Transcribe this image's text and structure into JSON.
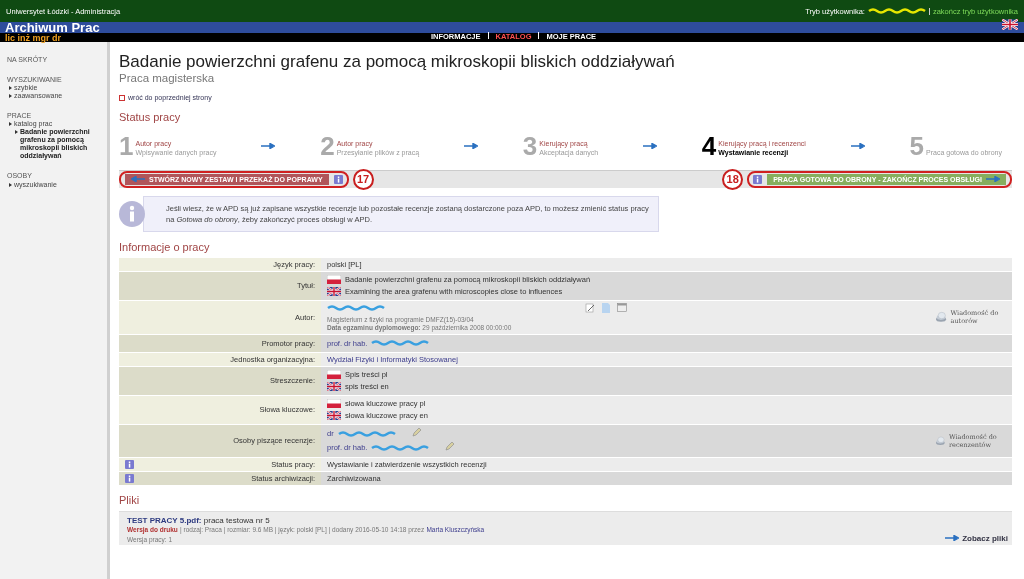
{
  "top_bar": {
    "institution": "Uniwersytet Łódzki - Administracja",
    "mode_label": "Tryb użytkownika:",
    "end_mode_link": "zakończ tryb użytkownika"
  },
  "header": {
    "title": "Archiwum Prac",
    "subtitle": "lic inż mgr dr",
    "nav": [
      {
        "label": "INFORMACJE",
        "selected": false
      },
      {
        "label": "KATALOG",
        "selected": true
      },
      {
        "label": "MOJE PRACE",
        "selected": false
      }
    ]
  },
  "sidebar": {
    "sections": [
      {
        "heading": "NA SKRÓTY"
      },
      {
        "heading": "WYSZUKIWANIE",
        "items": [
          {
            "label": "szybkie"
          },
          {
            "label": "zaawansowane"
          }
        ]
      },
      {
        "heading": "PRACE",
        "items": [
          {
            "label": "katalog prac",
            "children": [
              {
                "label": "Badanie powierzchni grafenu za pomocą mikroskopii bliskich oddziaływań"
              }
            ]
          }
        ]
      },
      {
        "heading": "OSOBY",
        "items": [
          {
            "label": "wyszukiwanie"
          }
        ]
      }
    ]
  },
  "page": {
    "title": "Badanie powierzchni grafenu za pomocą mikroskopii bliskich oddziaływań",
    "subtitle": "Praca magisterska",
    "back_link": "wróć do poprzedniej strony"
  },
  "status": {
    "heading": "Status pracy",
    "steps": [
      {
        "number": "1",
        "actor": "Autor pracy",
        "action": "Wpisywanie danych pracy",
        "selected": false
      },
      {
        "number": "2",
        "actor": "Autor pracy",
        "action": "Przesyłanie plików z pracą",
        "selected": false
      },
      {
        "number": "3",
        "actor": "Kierujący pracą",
        "action": "Akceptacja danych",
        "selected": false
      },
      {
        "number": "4",
        "actor": "Kierujący pracą i recenzenci",
        "action": "Wystawianie recenzji",
        "selected": true
      },
      {
        "number": "5",
        "action": "Praca gotowa do obrony",
        "selected": false
      }
    ]
  },
  "actions": {
    "back_button": "STWÓRZ NOWY ZESTAW I PRZEKAŻ DO POPRAWY",
    "back_marker": "17",
    "forward_marker": "18",
    "forward_button": "PRACA GOTOWA DO OBRONY - ZAKOŃCZ PROCES OBSŁUGI"
  },
  "notice": "Jeśli wiesz, że w APD są już zapisane wszystkie recenzje lub pozostałe recenzje zostaną dostarczone poza APD, to możesz zmienić status pracy na *Gotowa do obrony*, żeby zakończyć proces obsługi w APD.",
  "info": {
    "heading": "Informacje o pracy",
    "rows": [
      {
        "label": "Język pracy:",
        "kind": "text",
        "info_icon": false,
        "value": "polski [PL]"
      },
      {
        "label": "Tytuł:",
        "kind": "flags",
        "info_icon": false,
        "lines": [
          {
            "kind": "pl",
            "text": "Badanie powierzchni grafenu za pomocą mikroskopii bliskich oddziaływań"
          },
          {
            "kind": "en",
            "text": "Examining the area grafenu with microscopies close to influences"
          }
        ]
      },
      {
        "label": "Autor:",
        "kind": "author",
        "info_icon": false,
        "details": [
          "Magisterium z fizyki na programie DMFZ(15)-03/04",
          "**Data egzaminu dyplomowego:** 29 października 2008 00:00:00"
        ],
        "message_button": "Wiadomość do autorów"
      },
      {
        "label": "Promotor pracy:",
        "kind": "people",
        "info_icon": false,
        "people": [
          {
            "title": "prof. dr hab.",
            "editable": false
          }
        ]
      },
      {
        "label": "Jednostka organizacyjna:",
        "kind": "link",
        "info_icon": false,
        "value": "Wydział Fizyki i Informatyki Stosowanej"
      },
      {
        "label": "Streszczenie:",
        "kind": "flags",
        "info_icon": false,
        "lines": [
          {
            "kind": "pl",
            "text": "Spis treści pl"
          },
          {
            "kind": "en",
            "text": "spis treści en"
          }
        ]
      },
      {
        "label": "Słowa kluczowe:",
        "kind": "flags",
        "info_icon": false,
        "lines": [
          {
            "kind": "pl",
            "text": "słowa kluczowe pracy pl"
          },
          {
            "kind": "en",
            "text": "słowa kluczowe pracy en"
          }
        ]
      },
      {
        "label": "Osoby piszące recenzje:",
        "kind": "people",
        "info_icon": false,
        "people": [
          {
            "title": "dr",
            "editable": true
          },
          {
            "title": "prof. dr hab.",
            "editable": true
          }
        ],
        "message_button": "Wiadomość do recenzentów"
      },
      {
        "label": "Status pracy:",
        "kind": "text",
        "info_icon": true,
        "value": "Wystawianie i zatwierdzenie wszystkich recenzji"
      },
      {
        "label": "Status archiwizacji:",
        "kind": "text",
        "info_icon": true,
        "value": "Zarchiwizowana"
      }
    ]
  },
  "files": {
    "heading": "Pliki",
    "items": [
      {
        "name": "TEST PRACY 5.pdf:",
        "description": "praca testowa nr 5",
        "print_label": "Wersja do druku",
        "meta": "| rodzaj: Praca | rozmiar: 9.6 MB | język: polski [PL] | dodany 2016-05-10 14:18 przez",
        "uploader": "Marta Kluszczyńska",
        "version": "Wersja pracy: 1"
      }
    ],
    "view_link": "Zobacz pliki"
  }
}
